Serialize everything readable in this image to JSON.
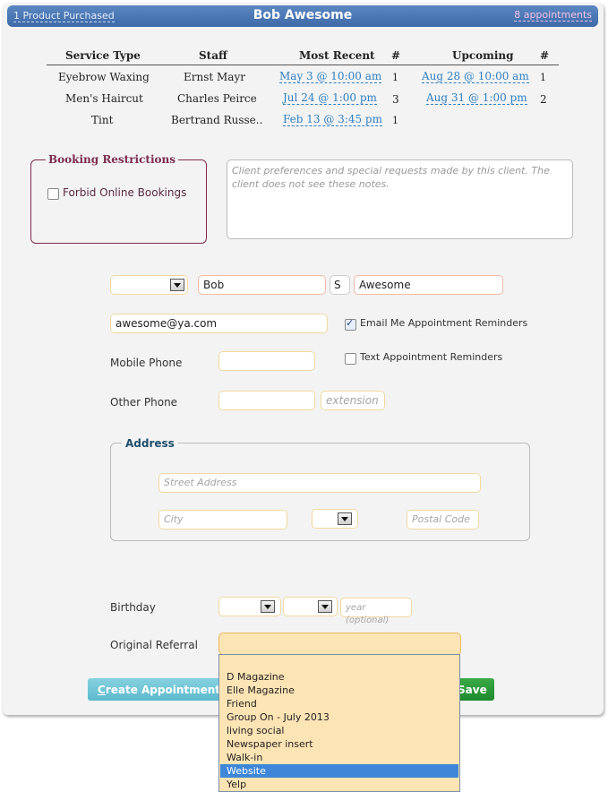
{
  "header": {
    "products_link": "1 Product Purchased",
    "client_name": "Bob Awesome",
    "appointments_link": "8 appointments"
  },
  "history": {
    "columns": [
      "Service Type",
      "Staff",
      "Most Recent",
      "#",
      "Upcoming",
      "#"
    ],
    "rows": [
      {
        "service": "Eyebrow Waxing",
        "staff": "Ernst Mayr",
        "recent": "May 3 @ 10:00 am",
        "recent_count": "1",
        "upcoming": "Aug 28 @ 10:00 am",
        "upcoming_count": "1"
      },
      {
        "service": "Men's Haircut",
        "staff": "Charles Peirce",
        "recent": "Jul 24 @ 1:00 pm",
        "recent_count": "3",
        "upcoming": "Aug 31 @ 1:00 pm",
        "upcoming_count": "2"
      },
      {
        "service": "Tint",
        "staff": "Bertrand Russe..",
        "recent": "Feb 13 @ 3:45 pm",
        "recent_count": "1",
        "upcoming": "",
        "upcoming_count": ""
      }
    ]
  },
  "restrictions": {
    "title": "Booking Restrictions",
    "forbid_online_label": "Forbid Online Bookings",
    "forbid_online_checked": false
  },
  "notes": {
    "placeholder": "Client preferences and special requests made by this client.  The client does not see these notes."
  },
  "name": {
    "prefix_value": "",
    "first": "Bob",
    "middle": "S",
    "last": "Awesome"
  },
  "contact": {
    "email": "awesome@ya.com",
    "email_reminders_label": "Email Me Appointment Reminders",
    "email_reminders_checked": true,
    "mobile_label": "Mobile Phone",
    "mobile_value": "",
    "text_reminders_label": "Text Appointment Reminders",
    "text_reminders_checked": false,
    "other_label": "Other Phone",
    "other_value": "",
    "extension_placeholder": "extension"
  },
  "address": {
    "title": "Address",
    "street_placeholder": "Street Address",
    "city_placeholder": "City",
    "state_value": "",
    "postal_placeholder": "Postal Code"
  },
  "birthday": {
    "label": "Birthday",
    "month_value": "",
    "day_value": "",
    "year_placeholder": "year (optional)"
  },
  "referral": {
    "label": "Original Referral",
    "selected_value": "",
    "options": [
      "",
      "D Magazine",
      "Elle Magazine",
      "Friend",
      "Group On - July 2013",
      "living social",
      "Newspaper insert",
      "Walk-in",
      "Website",
      "Yelp"
    ],
    "highlighted_index": 8
  },
  "actions": {
    "create_label_first": "C",
    "create_label_rest": "reate Appointment",
    "save_label": "Save"
  },
  "colors": {
    "header_blue": "#4a78b6",
    "restriction_maroon": "#7c2c4e",
    "link_blue": "#2f7fc2",
    "save_green": "#2a9a38",
    "create_teal": "#6cc3d6",
    "dropdown_bg": "#fde4b4",
    "dropdown_highlight": "#3d86d8"
  }
}
